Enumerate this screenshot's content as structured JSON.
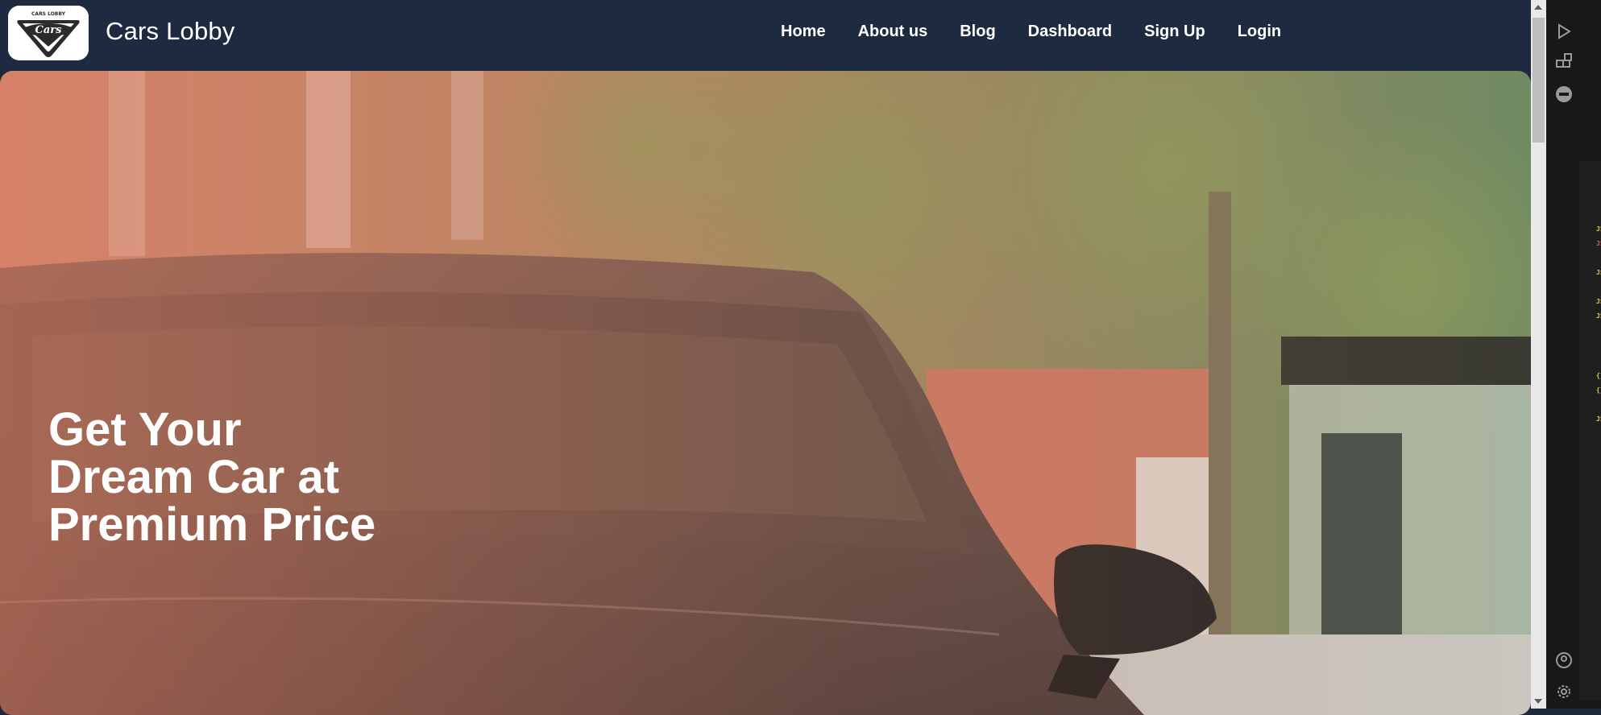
{
  "navbar": {
    "logo_text": "Cars",
    "logo_subtext": "CARS LOBBY",
    "brand": "Cars Lobby",
    "links": [
      "Home",
      "About us",
      "Blog",
      "Dashboard",
      "Sign Up",
      "Login"
    ]
  },
  "hero": {
    "title_lines": [
      "Get Your",
      "Dream Car at",
      "Premium Price"
    ]
  },
  "editor_sidebar": {
    "icons": [
      "run-debug-icon",
      "extensions-icon",
      "json-icon",
      "account-icon",
      "settings-icon"
    ],
    "file_types": [
      "JS",
      "JS",
      "JS",
      "JS",
      "JS",
      "JS",
      "{}",
      "{}",
      "JS"
    ]
  },
  "colors": {
    "navbar_bg": "#1e2a3f",
    "hero_tint": "#e07a5f",
    "text": "#ffffff"
  }
}
